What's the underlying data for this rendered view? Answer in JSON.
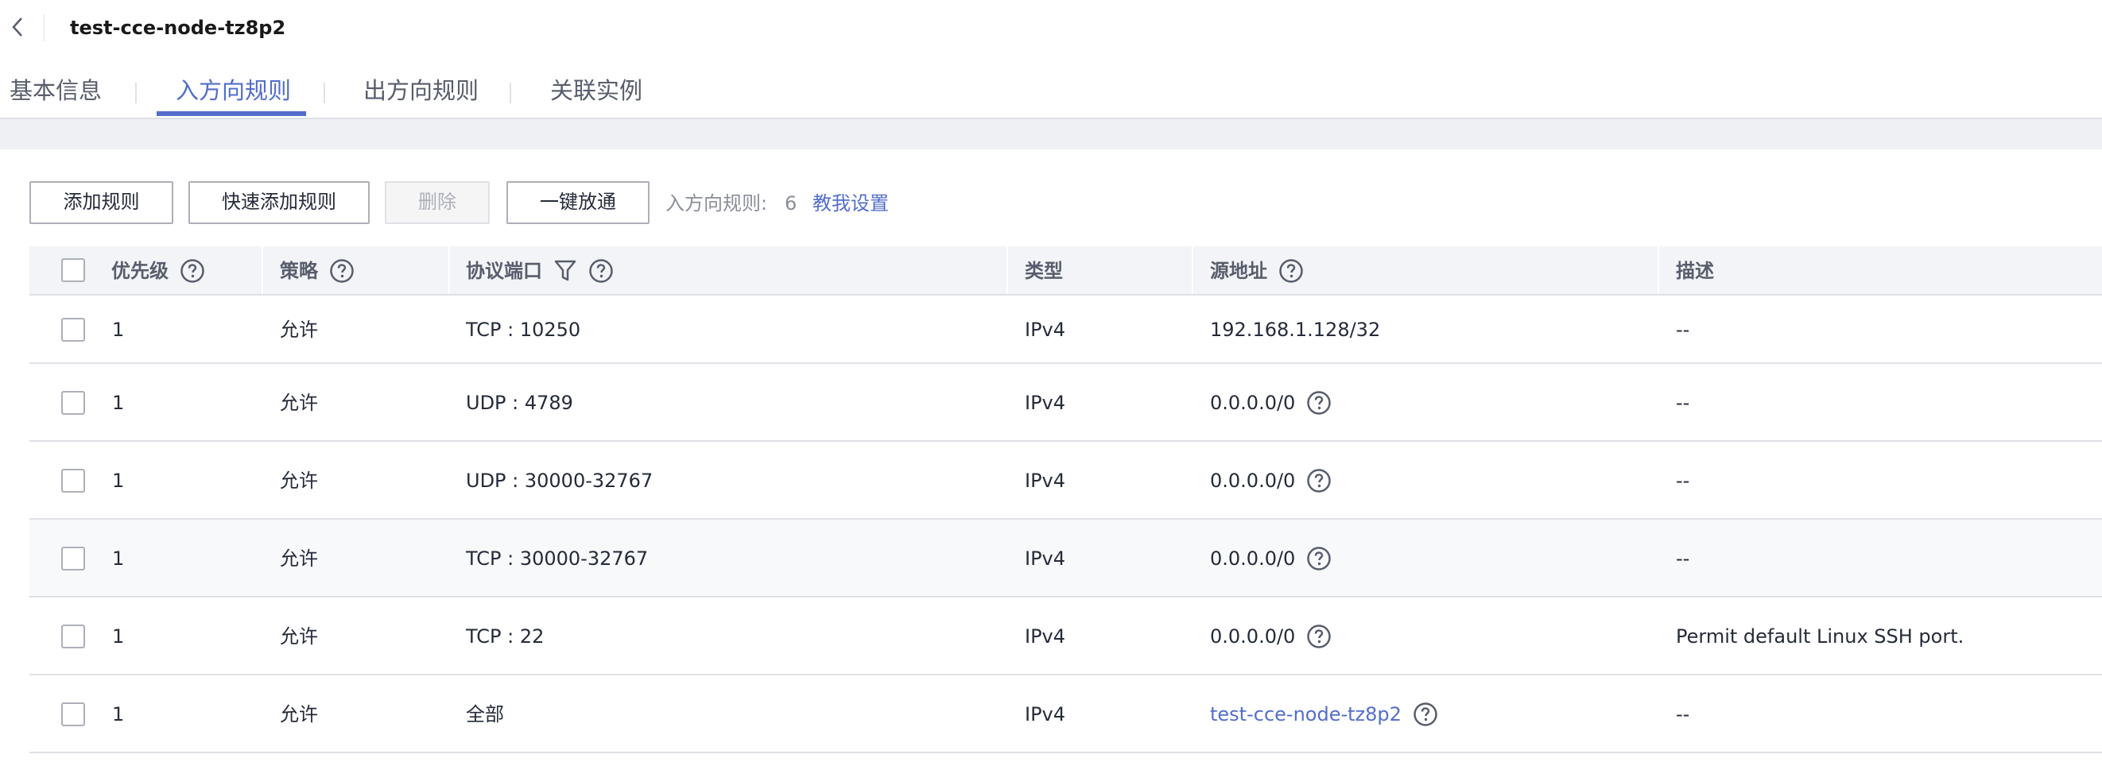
{
  "header": {
    "title": "test-cce-node-tz8p2",
    "back_icon": "chevron-left-icon"
  },
  "tabs": [
    {
      "label": "基本信息",
      "active": false
    },
    {
      "label": "入方向规则",
      "active": true
    },
    {
      "label": "出方向规则",
      "active": false
    },
    {
      "label": "关联实例",
      "active": false
    }
  ],
  "toolbar": {
    "add_rule": "添加规则",
    "quick_add_rule": "快速添加规则",
    "delete": "删除",
    "one_click_allow": "一键放通",
    "rule_count_label": "入方向规则:",
    "rule_count_value": "6",
    "guide_link": "教我设置"
  },
  "table": {
    "columns": {
      "priority": "优先级",
      "policy": "策略",
      "protocol_port": "协议端口",
      "type": "类型",
      "source": "源地址",
      "description": "描述"
    },
    "rows": [
      {
        "priority": "1",
        "policy": "允许",
        "protocol_port": "TCP : 10250",
        "type": "IPv4",
        "source": "192.168.1.128/32",
        "source_help": false,
        "source_link": false,
        "description": "--"
      },
      {
        "priority": "1",
        "policy": "允许",
        "protocol_port": "UDP : 4789",
        "type": "IPv4",
        "source": "0.0.0.0/0",
        "source_help": true,
        "source_link": false,
        "description": "--"
      },
      {
        "priority": "1",
        "policy": "允许",
        "protocol_port": "UDP : 30000-32767",
        "type": "IPv4",
        "source": "0.0.0.0/0",
        "source_help": true,
        "source_link": false,
        "description": "--"
      },
      {
        "priority": "1",
        "policy": "允许",
        "protocol_port": "TCP : 30000-32767",
        "type": "IPv4",
        "source": "0.0.0.0/0",
        "source_help": true,
        "source_link": false,
        "description": "--"
      },
      {
        "priority": "1",
        "policy": "允许",
        "protocol_port": "TCP : 22",
        "type": "IPv4",
        "source": "0.0.0.0/0",
        "source_help": true,
        "source_link": false,
        "description": "Permit default Linux SSH port."
      },
      {
        "priority": "1",
        "policy": "允许",
        "protocol_port": "全部",
        "type": "IPv4",
        "source": "test-cce-node-tz8p2",
        "source_help": true,
        "source_link": true,
        "description": "--"
      }
    ]
  },
  "colors": {
    "accent": "#526ecc",
    "text": "#252b3a",
    "muted": "#8a8e99",
    "border": "#dfe1e6",
    "header_bg": "#f3f4f7"
  }
}
